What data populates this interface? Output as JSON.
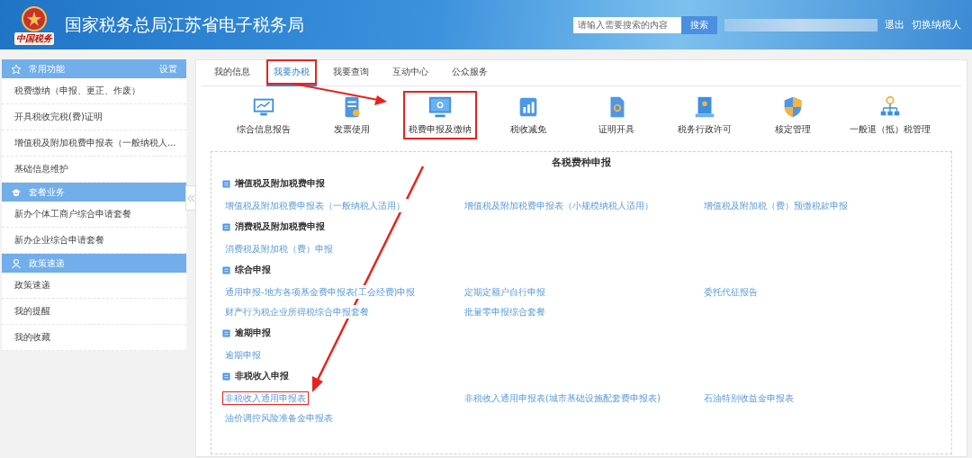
{
  "header": {
    "logo_text": "中国税务",
    "title": "国家税务总局江苏省电子税务局",
    "search": {
      "placeholder": "请输入需要搜索的内容",
      "button": "搜索"
    },
    "links": [
      "退出",
      "切换纳税人"
    ]
  },
  "sidebar": {
    "sections": [
      {
        "title": "常用功能",
        "action": "设置",
        "items": [
          "税费缴纳（申报、更正、作废）",
          "开具税收完税(费)证明",
          "增值税及附加税费申报表（一般纳税人...",
          "基础信息维护"
        ]
      },
      {
        "title": "套餐业务",
        "items": [
          "新办个体工商户综合申请套餐",
          "新办企业综合申请套餐"
        ]
      },
      {
        "title": "政策速递",
        "items": [
          "政策速递",
          "我的提醒",
          "我的收藏"
        ]
      }
    ]
  },
  "tabs": [
    {
      "label": "我的信息",
      "selected": false,
      "highlighted": false
    },
    {
      "label": "我要办税",
      "selected": true,
      "highlighted": true
    },
    {
      "label": "我要查询",
      "selected": false,
      "highlighted": false
    },
    {
      "label": "互动中心",
      "selected": false,
      "highlighted": false
    },
    {
      "label": "公众服务",
      "selected": false,
      "highlighted": false
    }
  ],
  "tiles": [
    {
      "label": "综合信息报告",
      "highlighted": false
    },
    {
      "label": "发票使用",
      "highlighted": false
    },
    {
      "label": "税费申报及缴纳",
      "highlighted": true
    },
    {
      "label": "税收减免",
      "highlighted": false
    },
    {
      "label": "证明开具",
      "highlighted": false
    },
    {
      "label": "税务行政许可",
      "highlighted": false
    },
    {
      "label": "核定管理",
      "highlighted": false
    },
    {
      "label": "一般退（抵）税管理",
      "highlighted": false
    }
  ],
  "panel": {
    "title": "各税费种申报",
    "groups": [
      {
        "title": "增值税及附加税费申报",
        "links": [
          {
            "label": "增值税及附加税费申报表（一般纳税人适用）",
            "highlighted": false
          },
          {
            "label": "增值税及附加税费申报表（小规模纳税人适用）",
            "highlighted": false
          },
          {
            "label": "增值税及附加税（费）预缴税款申报",
            "highlighted": false
          }
        ]
      },
      {
        "title": "消费税及附加税费申报",
        "links": [
          {
            "label": "消费税及附加税（费）申报",
            "highlighted": false
          }
        ]
      },
      {
        "title": "综合申报",
        "links": [
          {
            "label": "通用申报-地方各项基金费申报表(工会经费)申报",
            "highlighted": false
          },
          {
            "label": "定期定额户自行申报",
            "highlighted": false
          },
          {
            "label": "委托代征报告",
            "highlighted": false
          },
          {
            "label": "财产行为税企业所得税综合申报套餐",
            "highlighted": false
          },
          {
            "label": "批量零申报综合套餐",
            "highlighted": false
          }
        ]
      },
      {
        "title": "逾期申报",
        "links": [
          {
            "label": "逾期申报",
            "highlighted": false
          }
        ]
      },
      {
        "title": "非税收入申报",
        "links": [
          {
            "label": "非税收入通用申报表",
            "highlighted": true
          },
          {
            "label": "非税收入通用申报表(城市基础设施配套费申报表)",
            "highlighted": false
          },
          {
            "label": "石油特别收益金申报表",
            "highlighted": false
          },
          {
            "label": "油价调控风险准备金申报表",
            "highlighted": false
          }
        ]
      }
    ]
  }
}
